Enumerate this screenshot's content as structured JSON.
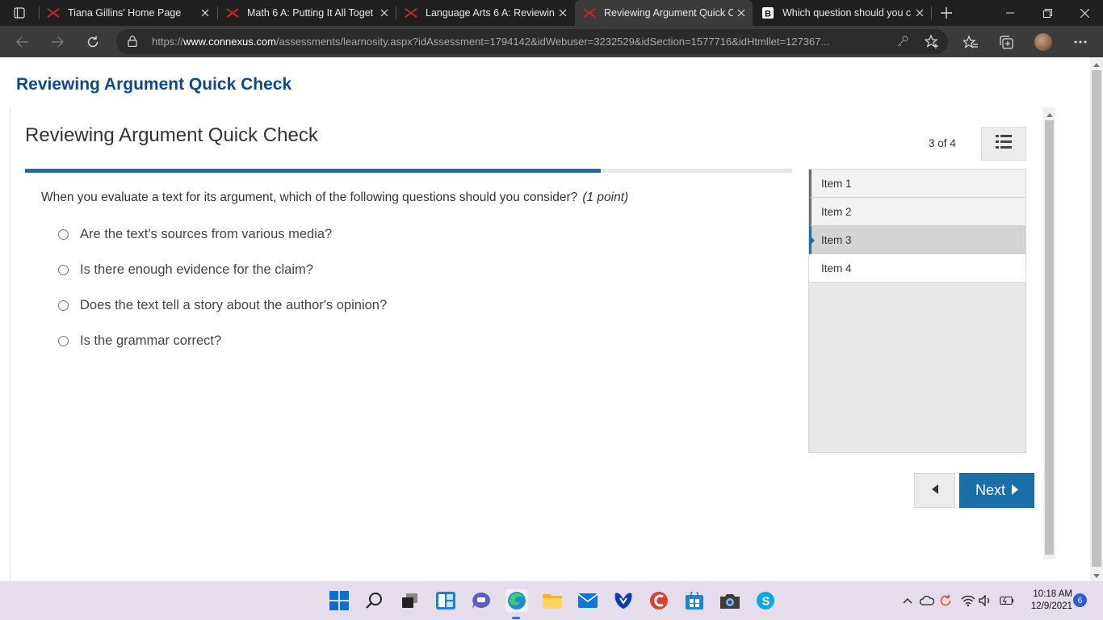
{
  "browser": {
    "tabs": [
      {
        "title": "Tiana Gillins' Home Page",
        "favicon": "connexus-logo-icon",
        "active": false
      },
      {
        "title": "Math 6 A: Putting It All Toget",
        "favicon": "connexus-logo-icon",
        "active": false
      },
      {
        "title": "Language Arts 6 A: Reviewing",
        "favicon": "connexus-logo-icon",
        "active": false
      },
      {
        "title": "Reviewing Argument Quick C",
        "favicon": "connexus-logo-icon",
        "active": true
      },
      {
        "title": "Which question should you c",
        "favicon": "brainly-logo-icon",
        "active": false
      }
    ],
    "url_prefix": "https://",
    "url_host": "www.connexus.com",
    "url_path": "/assessments/learnosity.aspx?idAssessment=1794142&idWebuser=3232529&idSection=1577716&idHtmllet=127367..."
  },
  "page": {
    "heading": "Reviewing Argument Quick Check"
  },
  "assessment": {
    "title": "Reviewing Argument Quick Check",
    "counter": "3 of 4",
    "progress_fraction": 0.75,
    "question": "When you evaluate a text for its argument, which of the following questions should you consider?",
    "points": "(1 point)",
    "options": [
      "Are the text's sources from various media?",
      "Is there enough evidence for the claim?",
      "Does the text tell a story about the author's opinion?",
      "Is the grammar correct?"
    ],
    "items": [
      "Item 1",
      "Item 2",
      "Item 3",
      "Item 4"
    ],
    "current_item": 3,
    "next_label": "Next"
  },
  "taskbar": {
    "apps": [
      "windows-start-icon",
      "search-icon",
      "task-view-icon",
      "widgets-icon",
      "teams-chat-icon",
      "edge-icon",
      "file-explorer-icon",
      "mail-icon",
      "malwarebytes-icon",
      "ccleaner-icon",
      "store-icon",
      "camera-icon",
      "skype-icon"
    ],
    "time": "10:18 AM",
    "date": "12/9/2021",
    "notifications": "6"
  }
}
